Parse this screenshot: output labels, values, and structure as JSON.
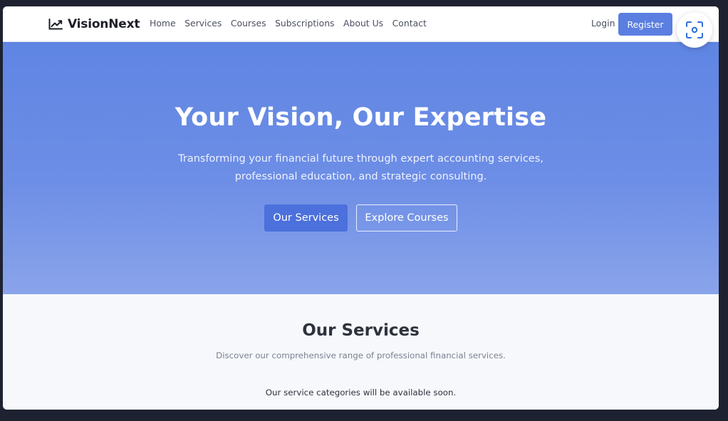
{
  "navbar": {
    "brand": "VisionNext",
    "links": [
      "Home",
      "Services",
      "Courses",
      "Subscriptions",
      "About Us",
      "Contact"
    ],
    "login": "Login",
    "register": "Register"
  },
  "hero": {
    "title": "Your Vision, Our Expertise",
    "subtitle": "Transforming your financial future through expert accounting services, professional education, and strategic consulting.",
    "primary_button": "Our Services",
    "secondary_button": "Explore Courses"
  },
  "services": {
    "title": "Our Services",
    "subtitle": "Discover our comprehensive range of professional financial services.",
    "empty_message": "Our service categories will be available soon."
  },
  "icons": {
    "brand": "chart-line-icon",
    "fab": "scan-icon"
  },
  "colors": {
    "accent": "#5a7fe0",
    "hero_top": "#5f85e3",
    "hero_bottom": "#8aa4ea",
    "fab_icon": "#2f6fd6"
  }
}
